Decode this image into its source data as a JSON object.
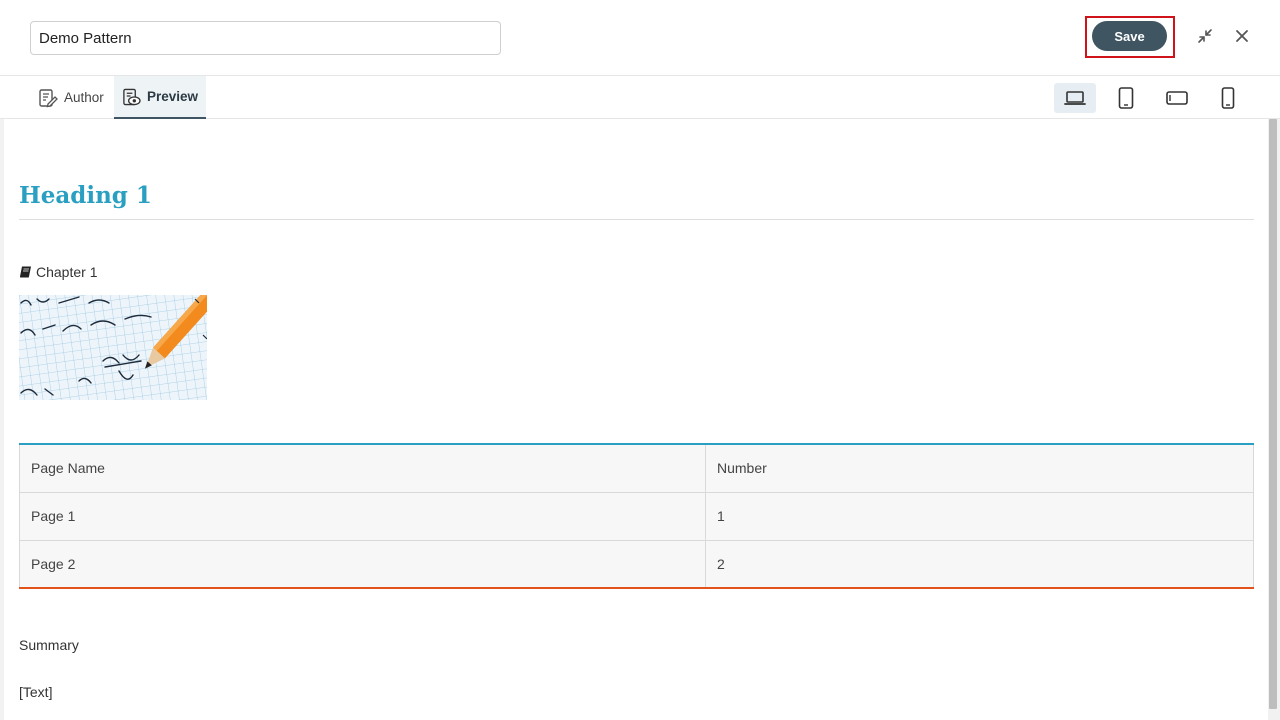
{
  "header": {
    "title_value": "Demo Pattern",
    "save_label": "Save"
  },
  "tabs": [
    {
      "label": "Author",
      "active": false
    },
    {
      "label": "Preview",
      "active": true
    }
  ],
  "devices": [
    "laptop-icon",
    "tablet-icon",
    "tablet-landscape-icon",
    "phone-icon"
  ],
  "content": {
    "heading": "Heading 1",
    "chapter": "Chapter 1",
    "table": {
      "headers": [
        "Page Name",
        "Number"
      ],
      "rows": [
        [
          "Page 1",
          "1"
        ],
        [
          "Page 2",
          "2"
        ]
      ]
    },
    "summary": "Summary",
    "text_placeholder": "[Text]"
  },
  "colors": {
    "accent": "#2a9fc1",
    "save_button": "#3f5562",
    "table_bottom": "#e2531b",
    "highlight": "#d0131b"
  }
}
